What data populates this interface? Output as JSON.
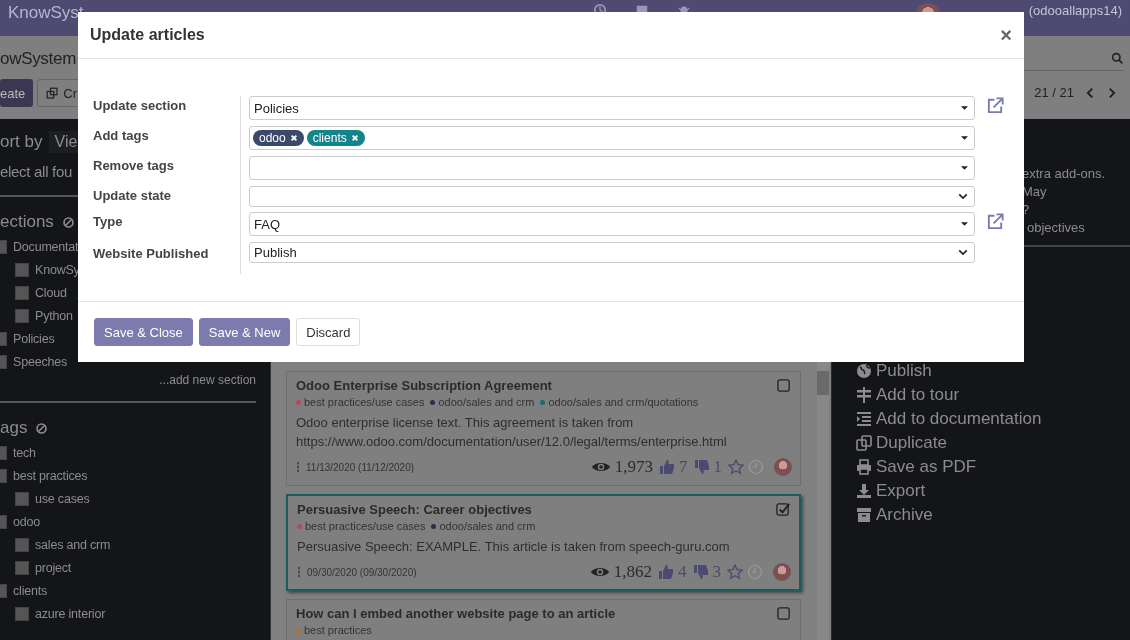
{
  "navbar": {
    "app": "KnowSyst",
    "user": "(odooallapps14)"
  },
  "control_panel": {
    "breadcrumb": "owSystem",
    "buttons": [
      {
        "label": "eate",
        "kind": "primary"
      },
      {
        "label": "Cr",
        "kind": "secondary"
      }
    ],
    "pager": "21 / 21"
  },
  "sidebar": {
    "sort_label": "ort by",
    "sort_button": "Vie",
    "select_all": "elect all fou",
    "add_section": "...add new section",
    "groups": [
      {
        "title": "ections",
        "items": [
          {
            "label": "Documentat",
            "checked": false,
            "children": [
              {
                "label": "KnowSy",
                "checked": false
              },
              {
                "label": "Cloud",
                "checked": false
              },
              {
                "label": "Python",
                "checked": false
              }
            ]
          },
          {
            "label": "Policies",
            "checked": false
          },
          {
            "label": "Speeches",
            "checked": false
          }
        ]
      },
      {
        "title": "ags",
        "items": [
          {
            "label": "tech",
            "checked": false
          },
          {
            "label": "best practices",
            "checked": false,
            "children": [
              {
                "label": "use cases",
                "checked": false
              }
            ]
          },
          {
            "label": "odoo",
            "checked": false,
            "children": [
              {
                "label": "sales and crm",
                "checked": false
              },
              {
                "label": "project",
                "checked": false
              }
            ]
          },
          {
            "label": "clients",
            "checked": false,
            "children": [
              {
                "label": "azure interior",
                "checked": false
              }
            ]
          }
        ]
      }
    ]
  },
  "articles": [
    {
      "title": "Odoo Enterprise Subscription Agreement",
      "selected": false,
      "tags": [
        {
          "label": "best practices/use cases",
          "color": "#b24a5a"
        },
        {
          "label": "odoo/sales and crm",
          "color": "#263047"
        },
        {
          "label": "odoo/sales and crm/quotations",
          "color": "#1d6a6a"
        }
      ],
      "text": "Odoo enterprise license text. This agreement is taken from https://www.odoo.com/documentation/user/12.0/legal/terms/enterprise.html",
      "date": "11/13/2020 (11/12/2020)",
      "views": "1,973",
      "likes": "7",
      "dislikes": "1"
    },
    {
      "title": "Persuasive Speech: Career objectives",
      "selected": true,
      "tags": [
        {
          "label": "best practices/use cases",
          "color": "#b24a5a"
        },
        {
          "label": "odoo/sales and crm",
          "color": "#263047"
        }
      ],
      "text": "Persuasive Speech: EXAMPLE. This article is taken from speech-guru.com",
      "date": "09/30/2020 (09/30/2020)",
      "views": "1,862",
      "likes": "4",
      "dislikes": "3"
    },
    {
      "title": "How can I embed another website page to an article",
      "selected": false,
      "tags": [
        {
          "label": "best practices",
          "color": "#b0703a"
        }
      ]
    }
  ],
  "right_panel": {
    "fragments": [
      "extra add-ons. May",
      "?",
      "objectives"
    ],
    "actions": [
      "Publish",
      "Add to tour",
      "Add to documentation",
      "Duplicate",
      "Save as PDF",
      "Export",
      "Archive"
    ]
  },
  "dialog": {
    "title": "Update articles",
    "close": "×",
    "fields": [
      {
        "label": "Update section",
        "kind": "many2one",
        "value": "Policies",
        "link": true
      },
      {
        "label": "Add tags",
        "kind": "tags",
        "tags": [
          {
            "label": "odoo",
            "color": "#3b4a6b"
          },
          {
            "label": "clients",
            "color": "#12848a"
          }
        ],
        "link": false
      },
      {
        "label": "Remove tags",
        "kind": "tags",
        "link": false
      },
      {
        "label": "Update state",
        "kind": "select",
        "link": false
      },
      {
        "label": "Type",
        "kind": "many2one",
        "value": "FAQ",
        "link": true
      },
      {
        "label": "Website Published",
        "kind": "select",
        "value": "Publish",
        "link": false
      }
    ],
    "buttons": [
      {
        "label": "Save & Close",
        "kind": "primary"
      },
      {
        "label": "Save & New",
        "kind": "primary"
      },
      {
        "label": "Discard",
        "kind": "secondary"
      }
    ]
  }
}
